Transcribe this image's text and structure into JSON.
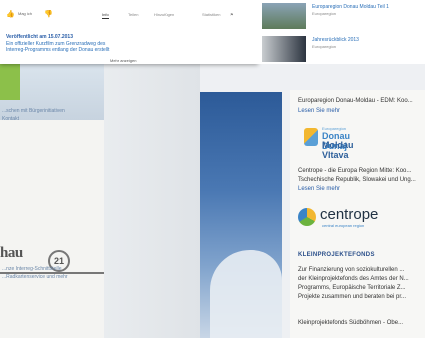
{
  "popup": {
    "actions": {
      "like": "Mag ich"
    },
    "tabs": [
      "Info",
      "Teilen",
      "Hinzufügen",
      "Statistiken"
    ],
    "published": "Veröffentlicht am 15.07.2013",
    "desc_line1": "Ein offizieller Kurzfilm zum Grenzradweg des",
    "desc_line2": "Interreg-Programms entlang der Donau erstellt",
    "more": "Mehr anzeigen"
  },
  "videos": [
    {
      "title": "Europaregion Donau Moldau Teil 1",
      "sub": "Europaregion"
    },
    {
      "title": "Jahresrückblick 2013",
      "sub": "Europaregion"
    }
  ],
  "left": {
    "logo_text": "hau",
    "logo_number": "21",
    "caption1": "...nze Interreg-Schnittstelle",
    "caption2": "...Radkartenservice und mehr",
    "side1": "...schen mit Bürgerinitiativen",
    "side2": "Kontakt"
  },
  "right": {
    "line1": "Europaregion Donau-Moldau - EDM: Koo...",
    "line2": "Lesen Sie mehr",
    "dm_small": "Europaregion",
    "dm_line1": "Donau Dunaj",
    "dm_line2": "Moldau Vltava",
    "line3": "Centrope - die Europa Region Mitte: Koo...",
    "line4": "Tschechische Republik, Slowakei und Ung...",
    "line5": "Lesen Sie mehr",
    "centrope_word": "centrope",
    "centrope_sub": "central european region",
    "section": "KLEINPROJEKTEFONDS",
    "k1": "Zur Finanzierung von soziokulturellen ...",
    "k2": "der Kleinprojektefonds des Amtes der N...",
    "k3": "Programms, Europäische Territoriale Z...",
    "k4": "Projekte zusammen und beraten bei pr...",
    "k5": "Kleinprojektefonds Südböhmen - Obe..."
  }
}
